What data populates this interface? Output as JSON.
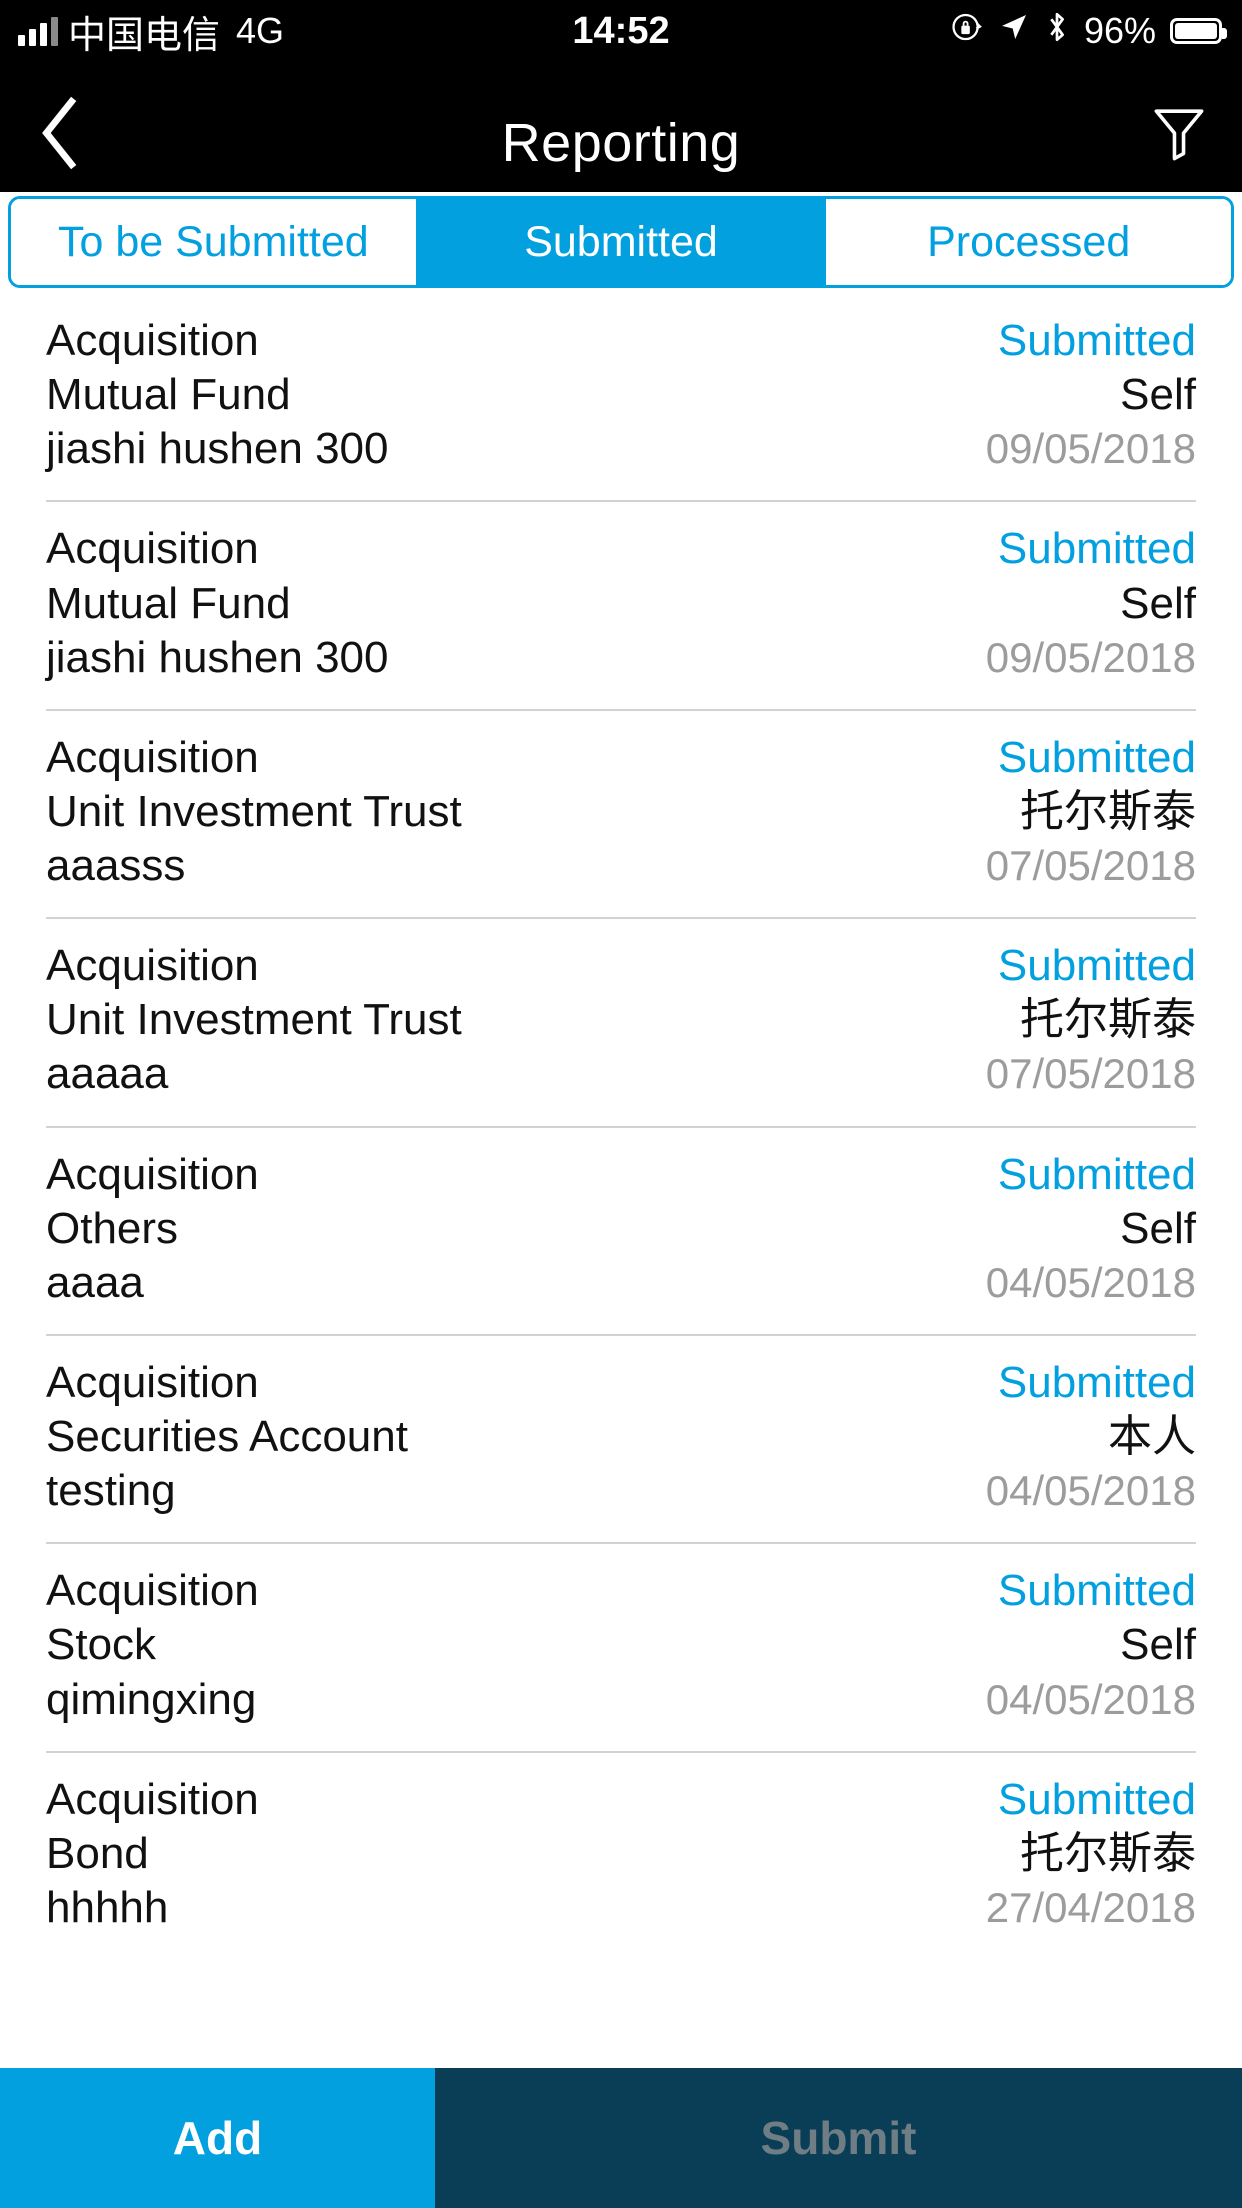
{
  "status_bar": {
    "carrier": "中国电信",
    "network": "4G",
    "time": "14:52",
    "battery_percent": "96%",
    "icons": [
      "signal-icon",
      "rotation-lock-icon",
      "location-arrow-icon",
      "bluetooth-icon",
      "battery-icon"
    ]
  },
  "navbar": {
    "title": "Reporting",
    "back_icon": "chevron-left-icon",
    "filter_icon": "filter-funnel-icon"
  },
  "tabs": [
    {
      "label": "To be Submitted",
      "active": false
    },
    {
      "label": "Submitted",
      "active": true
    },
    {
      "label": "Processed",
      "active": false
    }
  ],
  "colors": {
    "accent_blue": "#03a0e0",
    "submit_bg": "#0a3d56",
    "submit_text": "#6f7d85",
    "date_gray": "#9c9c9c",
    "divider": "#d2d2d2"
  },
  "list": [
    {
      "type": "Acquisition",
      "category": "Mutual Fund",
      "name": "jiashi hushen 300",
      "status": "Submitted",
      "person": "Self",
      "date": "09/05/2018"
    },
    {
      "type": "Acquisition",
      "category": "Mutual Fund",
      "name": "jiashi hushen 300",
      "status": "Submitted",
      "person": "Self",
      "date": "09/05/2018"
    },
    {
      "type": "Acquisition",
      "category": "Unit Investment Trust",
      "name": "aaasss",
      "status": "Submitted",
      "person": "托尔斯泰",
      "date": "07/05/2018"
    },
    {
      "type": "Acquisition",
      "category": "Unit Investment Trust",
      "name": "aaaaa",
      "status": "Submitted",
      "person": "托尔斯泰",
      "date": "07/05/2018"
    },
    {
      "type": "Acquisition",
      "category": "Others",
      "name": "aaaa",
      "status": "Submitted",
      "person": "Self",
      "date": "04/05/2018"
    },
    {
      "type": "Acquisition",
      "category": "Securities Account",
      "name": "testing",
      "status": "Submitted",
      "person": "本人",
      "date": "04/05/2018"
    },
    {
      "type": "Acquisition",
      "category": "Stock",
      "name": "qimingxing",
      "status": "Submitted",
      "person": "Self",
      "date": "04/05/2018"
    },
    {
      "type": "Acquisition",
      "category": "Bond",
      "name": "hhhhh",
      "status": "Submitted",
      "person": "托尔斯泰",
      "date": "27/04/2018"
    }
  ],
  "bottom_bar": {
    "add_label": "Add",
    "submit_label": "Submit"
  }
}
